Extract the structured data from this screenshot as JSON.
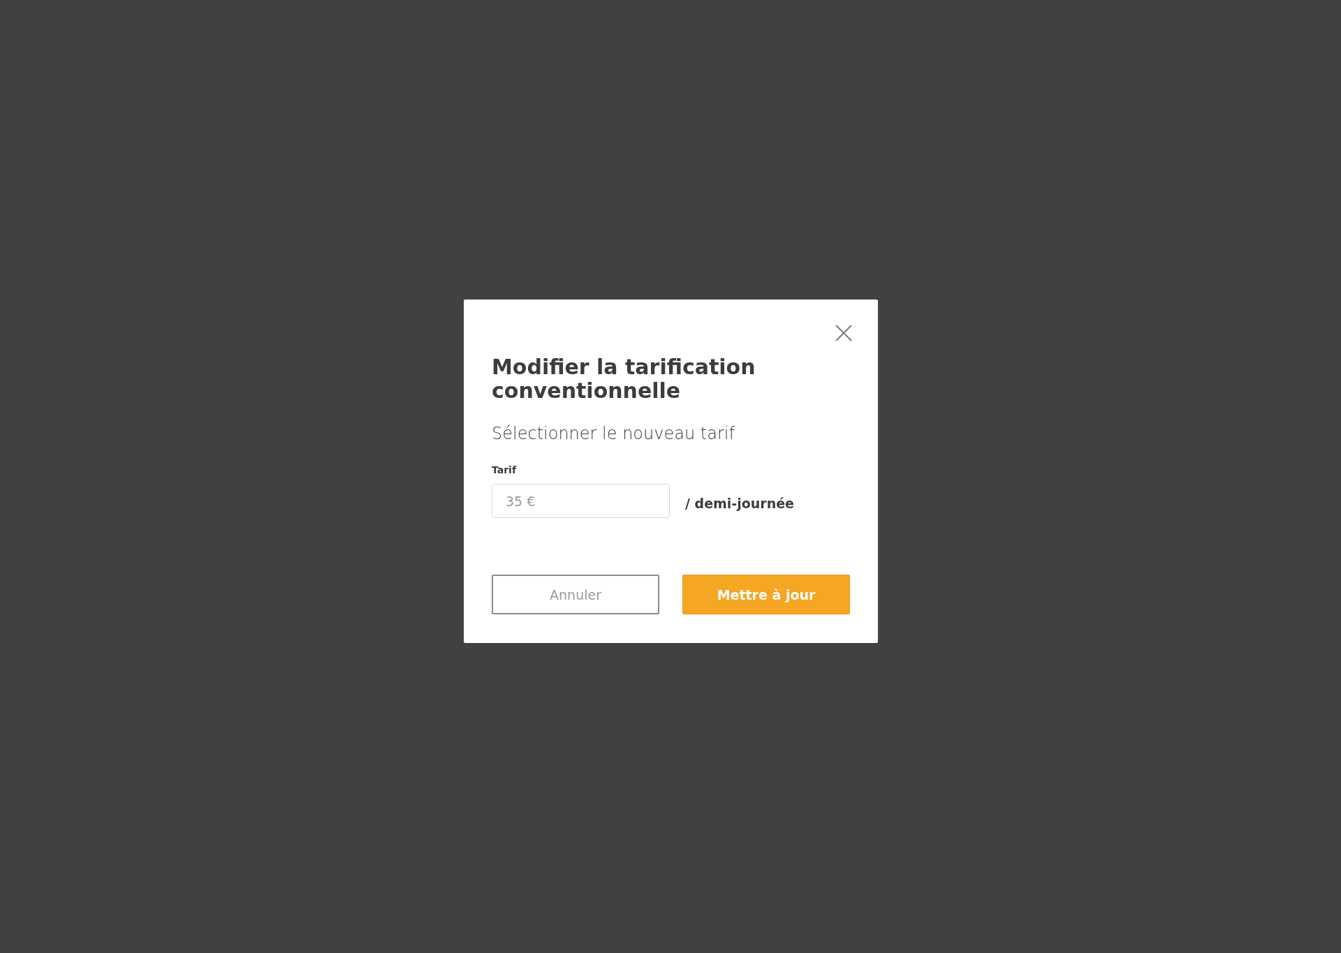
{
  "dialog": {
    "title": "Modifier la tarification conventionnelle",
    "subtitle": "Sélectionner le nouveau tarif",
    "field": {
      "label": "Tarif",
      "placeholder": "35 €",
      "unit": "/ demi-journée"
    },
    "buttons": [
      {
        "kind": "secondary",
        "label": "Annuler"
      },
      {
        "kind": "primary",
        "label": "Mettre à jour"
      }
    ]
  }
}
